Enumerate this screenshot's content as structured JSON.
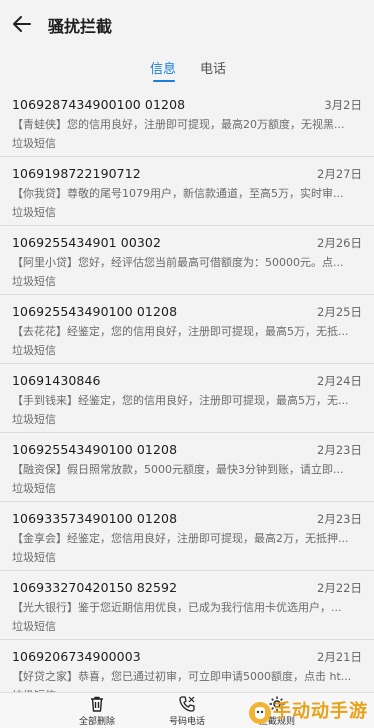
{
  "header": {
    "title": "骚扰拦截"
  },
  "tabs": [
    {
      "label": "信息"
    },
    {
      "label": "电话"
    }
  ],
  "messages": [
    {
      "number": "1069287434900100 01208",
      "date": "3月2日",
      "preview": "【青蛙侠】您的信用良好，注册即可提现，最高20万额度，无视黑...",
      "tag": "垃圾短信"
    },
    {
      "number": "1069198722190712",
      "date": "2月27日",
      "preview": "【你我贷】尊敬的尾号1079用户，新信款通道，至高5万，实时审...",
      "tag": "垃圾短信"
    },
    {
      "number": "1069255434901 00302",
      "date": "2月26日",
      "preview": "【阿里小贷】您好，经评估您当前最高可借额度为：50000元。点...",
      "tag": "垃圾短信"
    },
    {
      "number": "106925543490100 01208",
      "date": "2月25日",
      "preview": "【去花花】经鉴定，您的信用良好，注册即可提现，最高5万，无抵...",
      "tag": "垃圾短信"
    },
    {
      "number": "10691430846",
      "date": "2月24日",
      "preview": "【手到钱来】经鉴定，您的信用良好，注册即可提现，最高5万，无...",
      "tag": "垃圾短信"
    },
    {
      "number": "106925543490100 01208",
      "date": "2月23日",
      "preview": "【融资保】假日照常放款，5000元额度，最快3分钟到账，请立即...",
      "tag": "垃圾短信"
    },
    {
      "number": "106933573490100 01208",
      "date": "2月23日",
      "preview": "【金享会】经鉴定，您信用良好，注册即可提现，最高2万，无抵押...",
      "tag": "垃圾短信"
    },
    {
      "number": "106933270420150 82592",
      "date": "2月22日",
      "preview": "【光大银行】鉴于您近期信用优良，已成为我行信用卡优选用户，...",
      "tag": "垃圾短信"
    },
    {
      "number": "1069206734900003",
      "date": "2月21日",
      "preview": "【好贷之家】恭喜，您已通过初审，可立即申请5000额度，点击 ht...",
      "tag": "垃圾短信"
    }
  ],
  "bottom_bar": [
    {
      "label": "全部删除",
      "icon": "trash-icon"
    },
    {
      "label": "号码电话",
      "icon": "phone-icon"
    },
    {
      "label": "拦截规则",
      "icon": "settings-icon"
    }
  ],
  "watermark": {
    "text": "手动动手游"
  },
  "colors": {
    "accent": "#1a7de0",
    "background": "#f3f3f3",
    "divider": "#dcdcdc"
  }
}
